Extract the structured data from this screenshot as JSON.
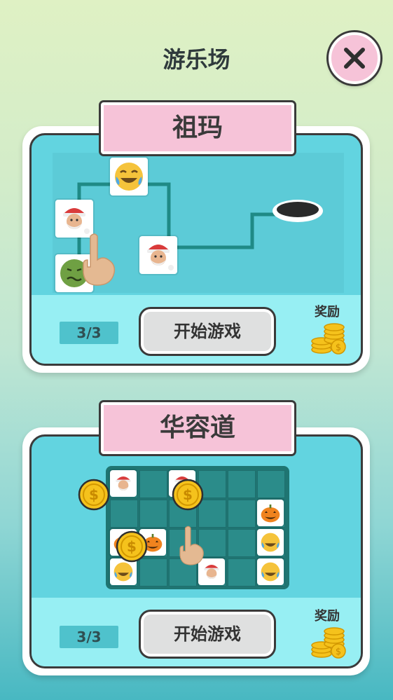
{
  "header": {
    "title": "游乐场",
    "close_icon": "close-icon"
  },
  "games": [
    {
      "name": "祖玛",
      "progress": "3/3",
      "start_label": "开始游戏",
      "reward_label": "奖励",
      "pieces": [
        "laughing-tears-icon",
        "santa-icon",
        "santa-icon",
        "nauseated-face-icon"
      ],
      "hint": "pointing-hand-icon",
      "target": "hole-icon"
    },
    {
      "name": "华容道",
      "progress": "3/3",
      "start_label": "开始游戏",
      "reward_label": "奖励",
      "pieces": [
        "santa-icon",
        "santa-icon",
        "pumpkin-icon",
        "laughing-tears-icon",
        "laughing-tears-icon",
        "pumpkin-icon",
        "pumpkin-icon",
        "laughing-tears-icon",
        "santa-icon"
      ],
      "hint": "pointing-hand-icon",
      "coins": [
        "dollar-coin-icon",
        "dollar-coin-icon",
        "dollar-coin-icon"
      ]
    }
  ],
  "colors": {
    "accent_pink": "#f6c3d8",
    "card_teal": "#62d4e0",
    "card_light": "#97eff3",
    "grid": "#2b8c8a"
  }
}
